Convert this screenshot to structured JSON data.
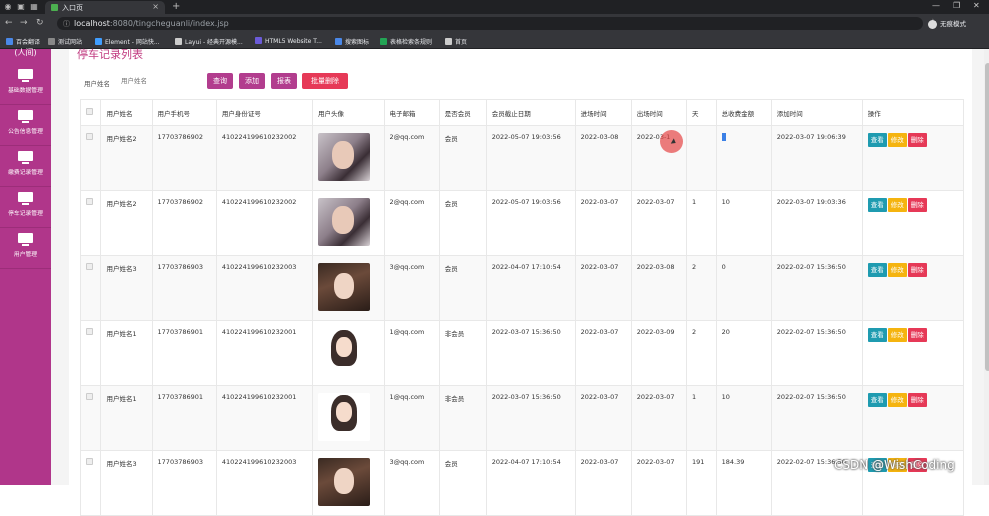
{
  "browser": {
    "tab_title": "入口页",
    "url_host": "localhost",
    "url_path": ":8080/tingcheguanli/index.jsp",
    "incognito_label": "无痕模式",
    "bookmarks": [
      {
        "label": "百会翻译",
        "color": "#4a88e8"
      },
      {
        "label": "测试网站",
        "color": "#888888"
      },
      {
        "label": "Element - 网站快...",
        "color": "#409eff"
      },
      {
        "label": "Layui - 经典开源模...",
        "color": "#cccccc"
      },
      {
        "label": "HTML5 Website T...",
        "color": "#6b5bd8"
      },
      {
        "label": "搜索图标",
        "color": "#4a88e8"
      },
      {
        "label": "表格检索条规则",
        "color": "#23a455"
      },
      {
        "label": "首页",
        "color": "#cccccc"
      }
    ]
  },
  "sidebar": {
    "top_fragment": "(人间)",
    "items": [
      {
        "label": "基础数据管理",
        "icon": "monitor-icon"
      },
      {
        "label": "公告信息管理",
        "icon": "monitor-icon"
      },
      {
        "label": "缴费记录管理",
        "icon": "monitor-icon"
      },
      {
        "label": "停车记录管理",
        "icon": "monitor-icon"
      },
      {
        "label": "用户管理",
        "icon": "monitor-icon"
      }
    ]
  },
  "page": {
    "title": "停车记录列表",
    "search_label": "用户姓名",
    "search_placeholder": "用户姓名",
    "buttons": {
      "query": "查询",
      "add": "添加",
      "report": "报表",
      "batch_delete": "批量删除"
    }
  },
  "colors": {
    "sidebar": "#b0368a",
    "query": "#b23d8e",
    "add": "#b23d8e",
    "report": "#b23d8e",
    "batch_delete": "#e63957",
    "view": "#1f9bb0",
    "edit": "#f5b40f",
    "delete": "#e63957"
  },
  "table": {
    "headers": [
      "用户姓名",
      "用户手机号",
      "用户身份证号",
      "用户头像",
      "电子邮箱",
      "是否会员",
      "会员截止日期",
      "进场时间",
      "出场时间",
      "天",
      "总收费金额",
      "添加时间",
      "操作"
    ],
    "actions": {
      "view": "查看",
      "edit": "修改",
      "delete": "删除"
    },
    "rows": [
      {
        "name": "用户姓名2",
        "phone": "17703786902",
        "idcard": "410224199610232002",
        "avatar": "woman-portrait",
        "email": "2@qq.com",
        "member": "会员",
        "expire": "2022-05-07 19:03:56",
        "enter": "2022-03-08",
        "exit": "2022-03-1",
        "days": "",
        "amount": "",
        "added": "2022-03-07 19:06:39"
      },
      {
        "name": "用户姓名2",
        "phone": "17703786902",
        "idcard": "410224199610232002",
        "avatar": "woman-portrait",
        "email": "2@qq.com",
        "member": "会员",
        "expire": "2022-05-07 19:03:56",
        "enter": "2022-03-07",
        "exit": "2022-03-07",
        "days": "1",
        "amount": "10",
        "added": "2022-03-07 19:03:36"
      },
      {
        "name": "用户姓名3",
        "phone": "17703786903",
        "idcard": "410224199610232003",
        "avatar": "girl-photo",
        "email": "3@qq.com",
        "member": "会员",
        "expire": "2022-04-07 17:10:54",
        "enter": "2022-03-07",
        "exit": "2022-03-08",
        "days": "2",
        "amount": "0",
        "added": "2022-02-07 15:36:50"
      },
      {
        "name": "用户姓名1",
        "phone": "17703786901",
        "idcard": "410224199610232001",
        "avatar": "cartoon-girl",
        "email": "1@qq.com",
        "member": "非会员",
        "expire": "2022-03-07 15:36:50",
        "enter": "2022-03-07",
        "exit": "2022-03-09",
        "days": "2",
        "amount": "20",
        "added": "2022-02-07 15:36:50"
      },
      {
        "name": "用户姓名1",
        "phone": "17703786901",
        "idcard": "410224199610232001",
        "avatar": "cartoon-girl",
        "email": "1@qq.com",
        "member": "非会员",
        "expire": "2022-03-07 15:36:50",
        "enter": "2022-03-07",
        "exit": "2022-03-07",
        "days": "1",
        "amount": "10",
        "added": "2022-02-07 15:36:50"
      },
      {
        "name": "用户姓名3",
        "phone": "17703786903",
        "idcard": "410224199610232003",
        "avatar": "girl-photo",
        "email": "3@qq.com",
        "member": "会员",
        "expire": "2022-04-07 17:10:54",
        "enter": "2022-03-07",
        "exit": "2022-03-07",
        "days": "191",
        "amount": "184.39",
        "added": "2022-02-07 15:36:50"
      }
    ]
  },
  "watermark": "CSDN @WishCoding"
}
